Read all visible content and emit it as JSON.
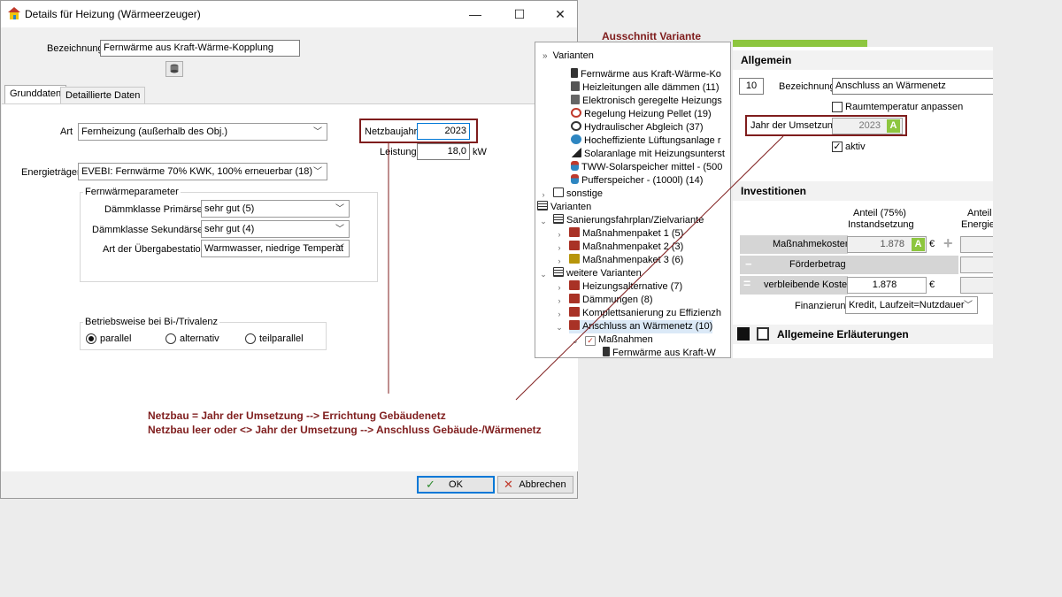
{
  "dialog": {
    "title": "Details für Heizung  (Wärmeerzeuger)",
    "bezeichnung_label": "Bezeichnung",
    "bezeichnung_value": "Fernwärme aus Kraft-Wärme-Kopplung",
    "tabs": [
      "Grunddaten",
      "Detaillierte Daten"
    ],
    "art_label": "Art",
    "art_value": "Fernheizung (außerhalb des Obj.)",
    "energietraeger_label": "Energieträger",
    "energietraeger_value": "EVEBI: Fernwärme 70% KWK, 100% erneuerbar (18)",
    "netzbaujahr_label": "Netzbaujahr",
    "netzbaujahr_value": "2023",
    "leistung_label": "Leistung",
    "leistung_value": "18,0",
    "leistung_unit": "kW",
    "fernwaerme_group": "Fernwärmeparameter",
    "daemm_primaer_label": "Dämmklasse Primärseite",
    "daemm_primaer_value": "sehr gut (5)",
    "daemm_sekundaer_label": "Dämmklasse Sekundärseite",
    "daemm_sekundaer_value": "sehr gut (4)",
    "uebergabe_label": "Art der Übergabestation",
    "uebergabe_value": "Warmwasser, niedrige Temperat",
    "betrieb_group": "Betriebsweise bei Bi-/Trivalenz",
    "radios": [
      "parallel",
      "alternativ",
      "teilparallel"
    ],
    "ok_label": "OK",
    "cancel_label": "Abbrechen"
  },
  "annotation": {
    "heading": "Ausschnitt Variante",
    "line1": "Netzbau = Jahr der Umsetzung --> Errichtung Gebäudenetz",
    "line2": "Netzbau leer oder <> Jahr der Umsetzung --> Anschluss Gebäude-/Wärmenetz"
  },
  "tree": {
    "items": [
      "Varianten",
      "Fernwärme aus Kraft-Wärme-Ko",
      "Heizleitungen alle dämmen (11)",
      "Elektronisch geregelte Heizungs",
      "Regelung Heizung Pellet (19)",
      "Hydraulischer Abgleich (37)",
      "Hocheffiziente Lüftungsanlage r",
      "Solaranlage mit Heizungsunterst",
      "TWW-Solarspeicher mittel - (500",
      "Pufferspeicher - (1000l) (14)",
      "sonstige",
      "Varianten",
      "Sanierungsfahrplan/Zielvariante",
      "Maßnahmenpaket 1 (5)",
      "Maßnahmenpaket 2 (3)",
      "Maßnahmenpaket 3 (6)",
      "weitere Varianten",
      "Heizungsalternative (7)",
      "Dämmungen (8)",
      "Komplettsanierung zu Effizienzh",
      "Anschluss an Wärmenetz (10)",
      "Maßnahmen",
      "Fernwärme aus Kraft-W"
    ]
  },
  "panel": {
    "allgemein": "Allgemein",
    "nummer": "10",
    "bezeichnung_label": "Bezeichnung",
    "bezeichnung_value": "Anschluss an Wärmenetz",
    "raumtemp_label": "Raumtemperatur anpassen",
    "jahr_label": "Jahr der Umsetzung",
    "jahr_value": "2023",
    "badge": "A",
    "aktiv_label": "aktiv",
    "investitionen": "Investitionen",
    "col1_line1": "Anteil (75%)",
    "col1_line2": "Instandsetzung",
    "col2_line1": "Anteil e",
    "col2_line2": "Energiee",
    "row1_label": "Maßnahmekosten",
    "row1_value": "1.878",
    "row2_label": "Förderbetrag",
    "row3_label": "verbleibende Kosten",
    "row3_value": "1.878",
    "currency": "€",
    "finanzierung_label": "Finanzierung",
    "finanzierung_value": "Kredit, Laufzeit=Nutzdauer",
    "erlaeuterungen": "Allgemeine Erläuterungen"
  },
  "colors": {
    "accent_red": "#7f1d1d",
    "accent_green": "#8dc63f"
  }
}
